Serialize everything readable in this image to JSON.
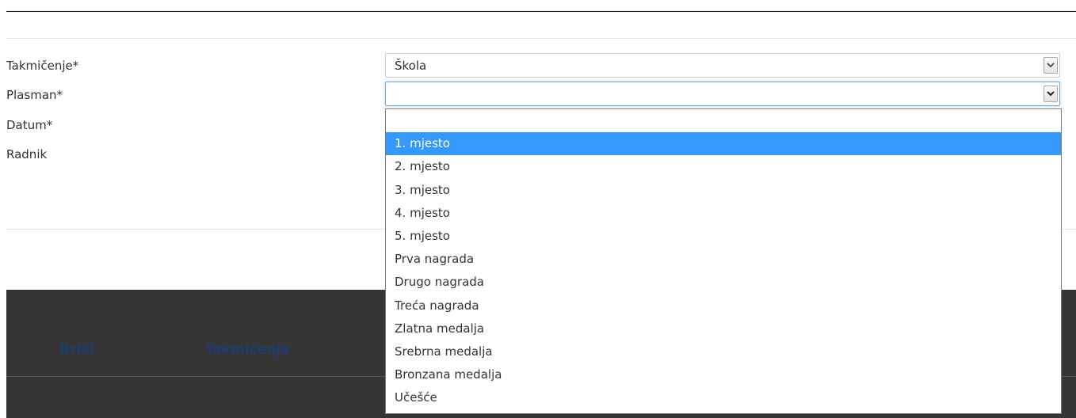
{
  "form": {
    "competition_label": "Takmičenje*",
    "placement_label": "Plasman*",
    "date_label": "Datum*",
    "worker_label": "Radnik",
    "competition_value": "Škola",
    "placement_value": ""
  },
  "table": {
    "headers": [
      "Briši",
      "Takmičenja"
    ]
  },
  "dropdown": {
    "options": [
      "",
      "1. mjesto",
      "2. mjesto",
      "3. mjesto",
      "4. mjesto",
      "5. mjesto",
      "Prva nagrada",
      "Drugo nagrada",
      "Treća nagrada",
      "Zlatna medalja",
      "Srebrna medalja",
      "Bronzana medalja",
      "Učešće"
    ],
    "highlighted_index": 1
  },
  "colors": {
    "highlight": "#3399ff",
    "dark_band": "#353535",
    "header_text": "#1b3f73"
  },
  "icons": {
    "select_arrow": "chevron-down-icon"
  }
}
